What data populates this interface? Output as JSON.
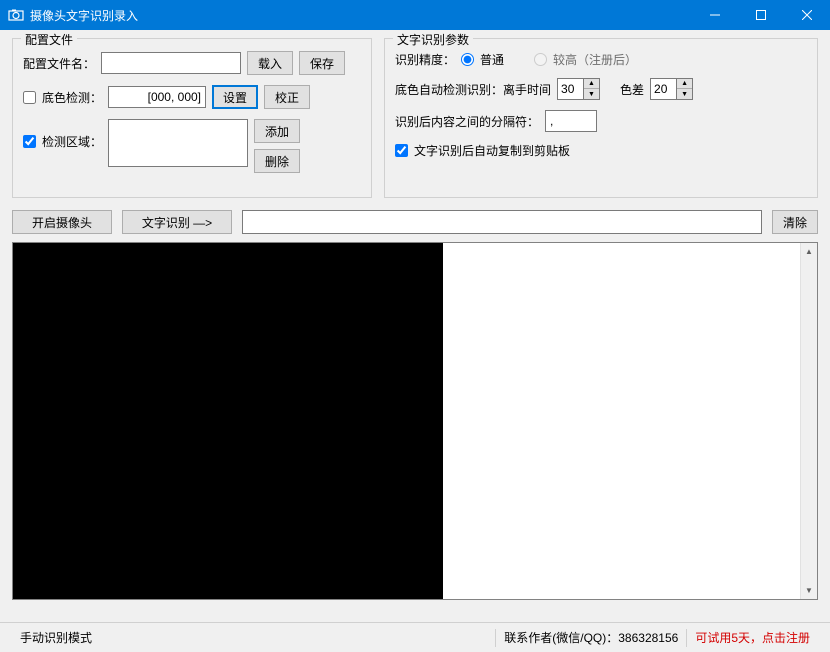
{
  "titlebar": {
    "title": "摄像头文字识别录入"
  },
  "group1": {
    "legend": "配置文件",
    "name_label": "配置文件名：",
    "name_value": "",
    "load_btn": "载入",
    "save_btn": "保存",
    "bgdetect_label": "底色检测：",
    "bgdetect_value": "[000, 000]",
    "set_btn": "设置",
    "correct_btn": "校正",
    "area_label": "检测区域：",
    "area_value": "",
    "add_btn": "添加",
    "del_btn": "删除"
  },
  "group2": {
    "legend": "文字识别参数",
    "precision_label": "识别精度：",
    "opt_normal": "普通",
    "opt_high": "较高（注册后）",
    "autodetect_label": "底色自动检测识别：离手时间",
    "leave_value": "30",
    "color_diff_label": "色差",
    "color_diff_value": "20",
    "separator_label": "识别后内容之间的分隔符：",
    "separator_value": ",",
    "copy_label": "文字识别后自动复制到剪贴板"
  },
  "toolbar": {
    "open_cam": "开启摄像头",
    "recognize": "文字识别 —>",
    "result_value": "",
    "clear": "清除"
  },
  "status": {
    "mode": "手动识别模式",
    "contact": "联系作者(微信/QQ)：386328156",
    "trial": "可试用5天，点击注册"
  }
}
